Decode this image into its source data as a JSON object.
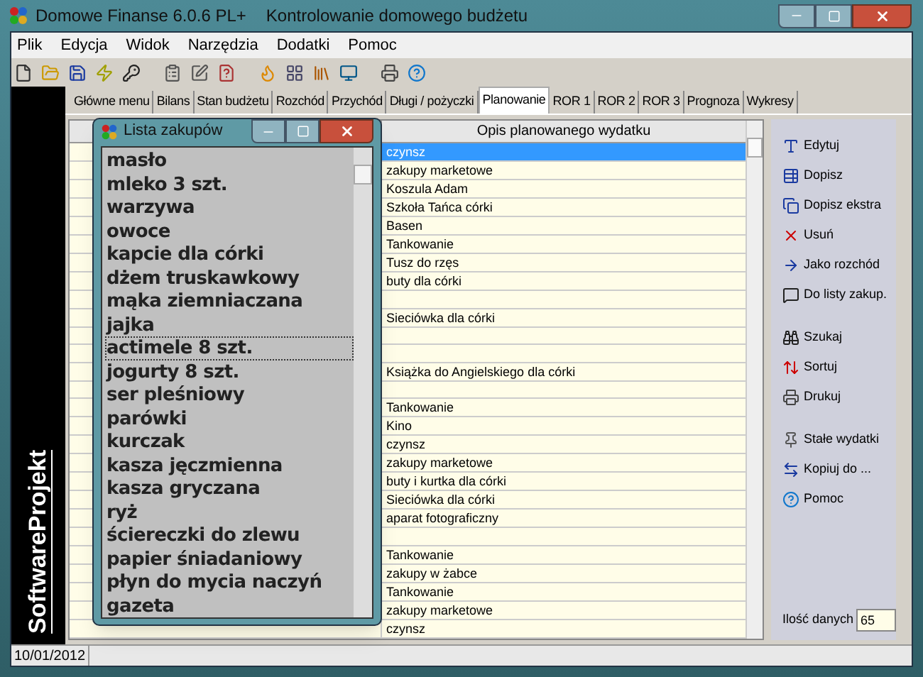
{
  "window": {
    "title": "Domowe Finanse 6.0.6 PL+",
    "subtitle": "Kontrolowanie domowego budżetu"
  },
  "menu": [
    "Plik",
    "Edycja",
    "Widok",
    "Narzędzia",
    "Dodatki",
    "Pomoc"
  ],
  "sidebar_logo": "SoftwareProjekt",
  "tabs": [
    {
      "label": "Główne menu",
      "selected": false
    },
    {
      "label": "Bilans",
      "selected": false
    },
    {
      "label": "Stan budżetu",
      "selected": false
    },
    {
      "label": "Rozchód",
      "selected": false
    },
    {
      "label": "Przychód",
      "selected": false
    },
    {
      "label": "Długi / pożyczki",
      "selected": false
    },
    {
      "label": "Planowanie",
      "selected": true
    },
    {
      "label": "ROR 1",
      "selected": false
    },
    {
      "label": "ROR 2",
      "selected": false
    },
    {
      "label": "ROR 3",
      "selected": false
    },
    {
      "label": "Prognoza",
      "selected": false
    },
    {
      "label": "Wykresy",
      "selected": false
    }
  ],
  "table": {
    "column_header": "Opis planowanego wydatku",
    "rows": [
      {
        "description": "czynsz",
        "selected": true
      },
      {
        "description": "zakupy marketowe",
        "selected": false
      },
      {
        "description": "Koszula Adam",
        "selected": false
      },
      {
        "description": "Szkoła Tańca córki",
        "selected": false
      },
      {
        "description": "Basen",
        "selected": false
      },
      {
        "description": "Tankowanie",
        "selected": false
      },
      {
        "description": "Tusz do rzęs",
        "selected": false
      },
      {
        "description": "buty dla córki",
        "selected": false
      },
      {
        "selected": false
      },
      {
        "description": "Sieciówka dla córki",
        "selected": false
      },
      {
        "selected": false
      },
      {
        "selected": false
      },
      {
        "description": "Książka do Angielskiego dla córki",
        "selected": false
      },
      {
        "selected": false
      },
      {
        "description": "Tankowanie",
        "selected": false
      },
      {
        "description": "Kino",
        "selected": false
      },
      {
        "description": "czynsz",
        "selected": false
      },
      {
        "description": "zakupy marketowe",
        "selected": false
      },
      {
        "description": "buty i kurtka dla córki",
        "selected": false
      },
      {
        "description": "Sieciówka dla córki",
        "selected": false
      },
      {
        "description": "aparat fotograficzny",
        "selected": false
      },
      {
        "selected": false
      },
      {
        "description": "Tankowanie",
        "selected": false
      },
      {
        "description": "zakupy w żabce",
        "selected": false
      },
      {
        "description": "Tankowanie",
        "selected": false
      },
      {
        "description": "zakupy marketowe",
        "selected": false
      },
      {
        "description": "czynsz",
        "selected": false
      }
    ]
  },
  "actions": [
    "Edytuj",
    "Dopisz",
    "Dopisz ekstra",
    "Usuń",
    "Jako rozchód",
    "Do listy zakup.",
    "Szukaj",
    "Sortuj",
    "Drukuj",
    "Stałe wydatki",
    "Kopiuj do ...",
    "Pomoc"
  ],
  "record_count": {
    "label": "Ilość danych",
    "value": "65"
  },
  "shopping_list": {
    "title": "Lista zakupów",
    "items": [
      {
        "text": "masło",
        "focused": false
      },
      {
        "text": "mleko 3 szt.",
        "focused": false
      },
      {
        "text": "warzywa",
        "focused": false
      },
      {
        "text": "owoce",
        "focused": false
      },
      {
        "text": "kapcie dla córki",
        "focused": false
      },
      {
        "text": "dżem truskawkowy",
        "focused": false
      },
      {
        "text": "mąka ziemniaczana",
        "focused": false
      },
      {
        "text": "jajka",
        "focused": false
      },
      {
        "text": "actimele 8 szt.",
        "focused": true
      },
      {
        "text": "jogurty 8 szt.",
        "focused": false
      },
      {
        "text": "ser pleśniowy",
        "focused": false
      },
      {
        "text": "parówki",
        "focused": false
      },
      {
        "text": "kurczak",
        "focused": false
      },
      {
        "text": "kasza jęczmienna",
        "focused": false
      },
      {
        "text": "kasza gryczana",
        "focused": false
      },
      {
        "text": "ryż",
        "focused": false
      },
      {
        "text": "ściereczki do zlewu",
        "focused": false
      },
      {
        "text": "papier śniadaniowy",
        "focused": false
      },
      {
        "text": "płyn do mycia naczyń",
        "focused": false
      },
      {
        "text": "gazeta",
        "focused": false
      }
    ]
  },
  "status_bar": {
    "date": "10/01/2012"
  }
}
